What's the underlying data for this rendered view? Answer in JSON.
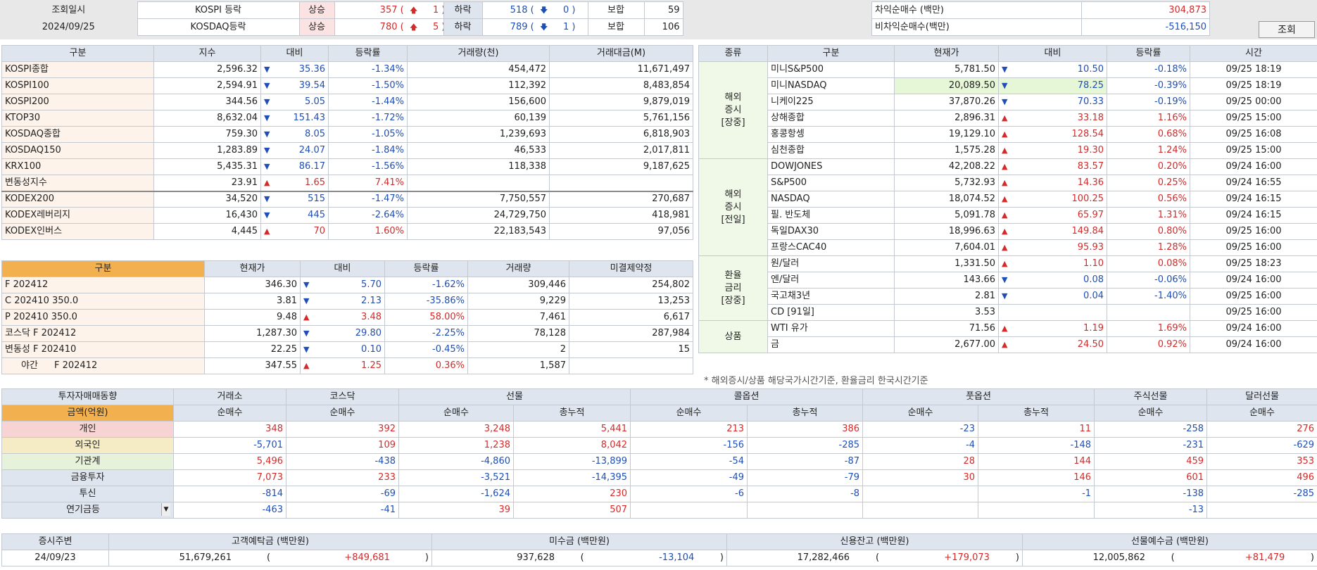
{
  "top": {
    "query_label": "조회일시",
    "query_date": "2024/09/25",
    "rows": [
      {
        "name": "KOSPI 등락",
        "up_label": "상승",
        "up_count": "357",
        "up_limit": "1",
        "down_label": "하락",
        "down_count": "518",
        "down_limit": "0",
        "flat_label": "보합",
        "flat_count": "59"
      },
      {
        "name": "KOSDAQ등락",
        "up_label": "상승",
        "up_count": "780",
        "up_limit": "5",
        "down_label": "하락",
        "down_count": "789",
        "down_limit": "1",
        "flat_label": "보합",
        "flat_count": "106"
      }
    ],
    "arb": [
      {
        "label": "차익순매수 (백만)",
        "value": "304,873"
      },
      {
        "label": "비차익순매수(백만)",
        "value": "-516,150"
      }
    ],
    "query_button": "조회"
  },
  "indices": {
    "headers": [
      "구분",
      "지수",
      "대비",
      "등락률",
      "거래량(천)",
      "거래대금(M)"
    ],
    "rows": [
      {
        "name": "KOSPI종합",
        "value": "2,596.32",
        "dir": "dn",
        "chg": "35.36",
        "pct": "-1.34%",
        "vol": "454,472",
        "amt": "11,671,497"
      },
      {
        "name": "KOSPI100",
        "value": "2,594.91",
        "dir": "dn",
        "chg": "39.54",
        "pct": "-1.50%",
        "vol": "112,392",
        "amt": "8,483,854"
      },
      {
        "name": "KOSPI200",
        "value": "344.56",
        "dir": "dn",
        "chg": "5.05",
        "pct": "-1.44%",
        "vol": "156,600",
        "amt": "9,879,019"
      },
      {
        "name": "KTOP30",
        "value": "8,632.04",
        "dir": "dn",
        "chg": "151.43",
        "pct": "-1.72%",
        "vol": "60,139",
        "amt": "5,761,156"
      },
      {
        "name": "KOSDAQ종합",
        "value": "759.30",
        "dir": "dn",
        "chg": "8.05",
        "pct": "-1.05%",
        "vol": "1,239,693",
        "amt": "6,818,903"
      },
      {
        "name": "KOSDAQ150",
        "value": "1,283.89",
        "dir": "dn",
        "chg": "24.07",
        "pct": "-1.84%",
        "vol": "46,533",
        "amt": "2,017,811"
      },
      {
        "name": "KRX100",
        "value": "5,435.31",
        "dir": "dn",
        "chg": "86.17",
        "pct": "-1.56%",
        "vol": "118,338",
        "amt": "9,187,625"
      },
      {
        "name": "변동성지수",
        "value": "23.91",
        "dir": "up",
        "chg": "1.65",
        "pct": "7.41%",
        "vol": "",
        "amt": ""
      },
      {
        "name": "KODEX200",
        "value": "34,520",
        "dir": "dn",
        "chg": "515",
        "pct": "-1.47%",
        "vol": "7,750,557",
        "amt": "270,687"
      },
      {
        "name": "KODEX레버리지",
        "value": "16,430",
        "dir": "dn",
        "chg": "445",
        "pct": "-2.64%",
        "vol": "24,729,750",
        "amt": "418,981"
      },
      {
        "name": "KODEX인버스",
        "value": "4,445",
        "dir": "up",
        "chg": "70",
        "pct": "1.60%",
        "vol": "22,183,543",
        "amt": "97,056"
      }
    ]
  },
  "futures": {
    "headers": [
      "구분",
      "현재가",
      "대비",
      "등락률",
      "거래량",
      "미결제약정"
    ],
    "rows": [
      {
        "name": "F 202412",
        "value": "346.30",
        "dir": "dn",
        "chg": "5.70",
        "pct": "-1.62%",
        "vol": "309,446",
        "oi": "254,802"
      },
      {
        "name": "C 202410 350.0",
        "value": "3.81",
        "dir": "dn",
        "chg": "2.13",
        "pct": "-35.86%",
        "vol": "9,229",
        "oi": "13,253"
      },
      {
        "name": "P 202410 350.0",
        "value": "9.48",
        "dir": "up",
        "chg": "3.48",
        "pct": "58.00%",
        "vol": "7,461",
        "oi": "6,617"
      },
      {
        "name": "코스닥 F 202412",
        "value": "1,287.30",
        "dir": "dn",
        "chg": "29.80",
        "pct": "-2.25%",
        "vol": "78,128",
        "oi": "287,984"
      },
      {
        "name": "변동성 F 202410",
        "value": "22.25",
        "dir": "dn",
        "chg": "0.10",
        "pct": "-0.45%",
        "vol": "2",
        "oi": "15"
      },
      {
        "name": "야간",
        "name2": "F 202412",
        "value": "347.55",
        "dir": "up",
        "chg": "1.25",
        "pct": "0.36%",
        "vol": "1,587",
        "oi": ""
      }
    ]
  },
  "world": {
    "headers": [
      "종류",
      "구분",
      "현재가",
      "대비",
      "등락률",
      "시간"
    ],
    "groups": [
      {
        "category": "해외\n증시\n[장중]",
        "rows": [
          {
            "name": "미니S&P500",
            "value": "5,781.50",
            "dir": "dn",
            "chg": "10.50",
            "pct": "-0.18%",
            "time": "09/25 18:19"
          },
          {
            "name": "미니NASDAQ",
            "value": "20,089.50",
            "dir": "dn",
            "chg": "78.25",
            "pct": "-0.39%",
            "time": "09/25 18:19"
          },
          {
            "name": "니케이225",
            "value": "37,870.26",
            "dir": "dn",
            "chg": "70.33",
            "pct": "-0.19%",
            "time": "09/25 00:00"
          },
          {
            "name": "상해종합",
            "value": "2,896.31",
            "dir": "up",
            "chg": "33.18",
            "pct": "1.16%",
            "time": "09/25 15:00"
          },
          {
            "name": "홍콩항셍",
            "value": "19,129.10",
            "dir": "up",
            "chg": "128.54",
            "pct": "0.68%",
            "time": "09/25 16:08"
          },
          {
            "name": "심천종합",
            "value": "1,575.28",
            "dir": "up",
            "chg": "19.30",
            "pct": "1.24%",
            "time": "09/25 15:00"
          }
        ]
      },
      {
        "category": "해외\n증시\n[전일]",
        "rows": [
          {
            "name": "DOWJONES",
            "value": "42,208.22",
            "dir": "up",
            "chg": "83.57",
            "pct": "0.20%",
            "time": "09/24 16:00"
          },
          {
            "name": "S&P500",
            "value": "5,732.93",
            "dir": "up",
            "chg": "14.36",
            "pct": "0.25%",
            "time": "09/24 16:55"
          },
          {
            "name": "NASDAQ",
            "value": "18,074.52",
            "dir": "up",
            "chg": "100.25",
            "pct": "0.56%",
            "time": "09/24 16:15"
          },
          {
            "name": "필. 반도체",
            "value": "5,091.78",
            "dir": "up",
            "chg": "65.97",
            "pct": "1.31%",
            "time": "09/24 16:15"
          },
          {
            "name": "독일DAX30",
            "value": "18,996.63",
            "dir": "up",
            "chg": "149.84",
            "pct": "0.80%",
            "time": "09/25 16:00"
          },
          {
            "name": "프랑스CAC40",
            "value": "7,604.01",
            "dir": "up",
            "chg": "95.93",
            "pct": "1.28%",
            "time": "09/25 16:00"
          }
        ]
      },
      {
        "category": "환율\n금리\n[장중]",
        "rows": [
          {
            "name": "원/달러",
            "value": "1,331.50",
            "dir": "up",
            "chg": "1.10",
            "pct": "0.08%",
            "time": "09/25 18:23"
          },
          {
            "name": "엔/달러",
            "value": "143.66",
            "dir": "dn",
            "chg": "0.08",
            "pct": "-0.06%",
            "time": "09/24 16:00"
          },
          {
            "name": "국고채3년",
            "value": "2.81",
            "dir": "dn",
            "chg": "0.04",
            "pct": "-1.40%",
            "time": "09/25 16:00"
          },
          {
            "name": "CD [91일]",
            "value": "3.53",
            "dir": "",
            "chg": "",
            "pct": "",
            "time": "09/25 16:00"
          }
        ]
      },
      {
        "category": "상품",
        "rows": [
          {
            "name": "WTI 유가",
            "value": "71.56",
            "dir": "up",
            "chg": "1.19",
            "pct": "1.69%",
            "time": "09/24 16:00"
          },
          {
            "name": "금",
            "value": "2,677.00",
            "dir": "up",
            "chg": "24.50",
            "pct": "0.92%",
            "time": "09/24 16:00"
          }
        ]
      }
    ],
    "note": "* 해외증시/상품 해당국가시간기준, 환율금리 한국시간기준"
  },
  "investors": {
    "title": "투자자매매동향",
    "unit": "금액(억원)",
    "groups": [
      "거래소",
      "코스닥",
      "선물",
      "콜옵션",
      "풋옵션",
      "주식선물",
      "달러선물"
    ],
    "sub": {
      "net": "순매수",
      "cum": "총누적"
    },
    "rows": [
      {
        "name": "개인",
        "vals": [
          "348",
          "392",
          "3,248",
          "5,441",
          "213",
          "386",
          "-23",
          "11",
          "-258",
          "276"
        ]
      },
      {
        "name": "외국인",
        "vals": [
          "-5,701",
          "109",
          "1,238",
          "8,042",
          "-156",
          "-285",
          "-4",
          "-148",
          "-231",
          "-629"
        ]
      },
      {
        "name": "기관계",
        "vals": [
          "5,496",
          "-438",
          "-4,860",
          "-13,899",
          "-54",
          "-87",
          "28",
          "144",
          "459",
          "353"
        ]
      },
      {
        "name": "금융투자",
        "vals": [
          "7,073",
          "233",
          "-3,521",
          "-14,395",
          "-49",
          "-79",
          "30",
          "146",
          "601",
          "496"
        ]
      },
      {
        "name": "투신",
        "vals": [
          "-814",
          "-69",
          "-1,624",
          "230",
          "-6",
          "-8",
          "",
          "-1",
          "-138",
          "-285"
        ]
      },
      {
        "name": "연기금등",
        "vals": [
          "-463",
          "-41",
          "39",
          "507",
          "",
          "",
          "",
          "",
          "-13",
          ""
        ]
      }
    ]
  },
  "deposits": {
    "headers": [
      "증시주변",
      "고객예탁금 (백만원)",
      "미수금 (백만원)",
      "신용잔고 (백만원)",
      "선물예수금 (백만원)"
    ],
    "date": "24/09/23",
    "items": [
      {
        "value": "51,679,261",
        "chg": "+849,681"
      },
      {
        "value": "937,628",
        "chg": "-13,104"
      },
      {
        "value": "17,282,466",
        "chg": "+179,073"
      },
      {
        "value": "12,005,862",
        "chg": "+81,479"
      }
    ]
  },
  "colors": {
    "up": "#d42a2a",
    "down": "#1f4fb5",
    "header": "#dfe5ee",
    "accent_header": "#f2b04e"
  },
  "icons": {
    "up": "arrow-up-icon",
    "down": "arrow-down-icon",
    "dropdown": "dropdown-icon"
  }
}
